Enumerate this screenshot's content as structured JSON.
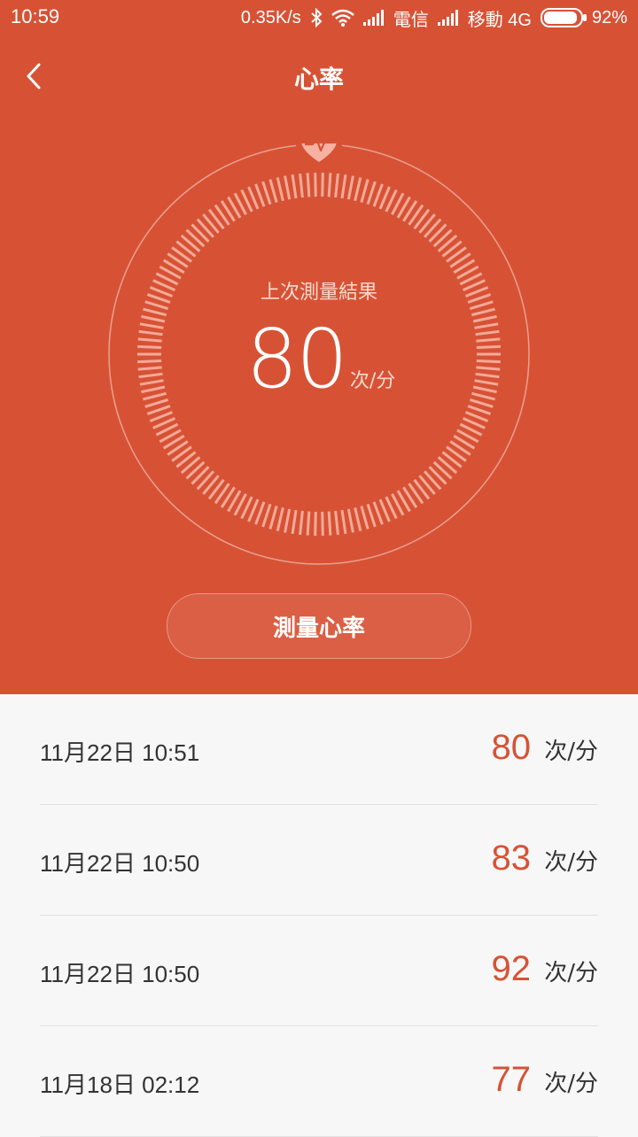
{
  "status_bar": {
    "time": "10:59",
    "speed": "0.35K/s",
    "carrier1": "電信",
    "carrier2": "移動 4G",
    "battery_percent": "92%",
    "battery_level": 0.92,
    "icons": [
      "bluetooth-icon",
      "wifi-icon",
      "signal-icon",
      "signal-icon",
      "battery-icon"
    ]
  },
  "header": {
    "title": "心率",
    "back_icon": "back-arrow-icon"
  },
  "dial": {
    "heart_icon": "heart-pulse-icon",
    "label": "上次測量結果",
    "value": "80",
    "unit": "次/分"
  },
  "measure_button": {
    "label": "測量心率"
  },
  "records": [
    {
      "date": "11月22日 10:51",
      "value": "80",
      "unit": "次/分"
    },
    {
      "date": "11月22日 10:50",
      "value": "83",
      "unit": "次/分"
    },
    {
      "date": "11月22日 10:50",
      "value": "92",
      "unit": "次/分"
    },
    {
      "date": "11月18日 02:12",
      "value": "77",
      "unit": "次/分"
    }
  ],
  "colors": {
    "accent": "#d75235",
    "list_background": "#f7f7f7",
    "divider": "#e2e2e2",
    "text_dark": "#333333"
  }
}
